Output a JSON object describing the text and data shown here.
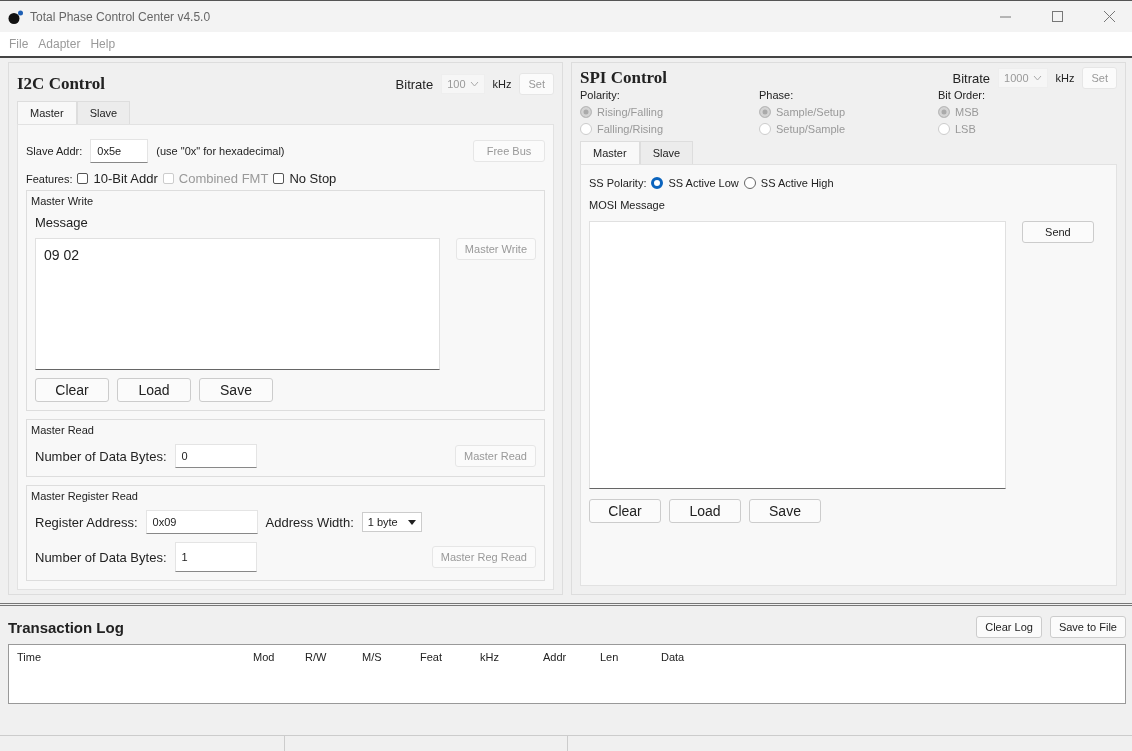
{
  "window": {
    "title": "Total Phase Control Center v4.5.0"
  },
  "menu": [
    {
      "label": "File"
    },
    {
      "label": "Adapter"
    },
    {
      "label": "Help"
    }
  ],
  "i2c": {
    "title": "I2C Control",
    "bitrate": {
      "label": "Bitrate",
      "value": "100",
      "unit": "kHz",
      "set": "Set",
      "disabled": true
    },
    "tabs": [
      {
        "label": "Master",
        "selected": true
      },
      {
        "label": "Slave",
        "selected": false
      }
    ],
    "slave_addr": {
      "label": "Slave Addr:",
      "value": "0x5e",
      "hint": "(use \"0x\" for hexadecimal)"
    },
    "free_bus": {
      "label": "Free Bus",
      "disabled": true
    },
    "features": {
      "label": "Features:",
      "options": [
        {
          "label": "10-Bit Addr",
          "checked": false,
          "disabled": false
        },
        {
          "label": "Combined FMT",
          "checked": false,
          "disabled": true
        },
        {
          "label": "No Stop",
          "checked": false,
          "disabled": false
        }
      ]
    },
    "master_write": {
      "title": "Master Write",
      "message_label": "Message",
      "message": "09 02",
      "button": {
        "label": "Master Write",
        "disabled": true
      },
      "buttons": [
        "Clear",
        "Load",
        "Save"
      ]
    },
    "master_read": {
      "title": "Master Read",
      "bytes_label": "Number of Data Bytes:",
      "bytes": "0",
      "button": {
        "label": "Master Read",
        "disabled": true
      }
    },
    "master_register_read": {
      "title": "Master Register Read",
      "address_label": "Register Address:",
      "address": "0x09",
      "width_label": "Address Width:",
      "width": "1 byte",
      "bytes_label": "Number of Data Bytes:",
      "bytes": "1",
      "button": {
        "label": "Master Reg Read",
        "disabled": true
      }
    }
  },
  "spi": {
    "title": "SPI Control",
    "bitrate": {
      "label": "Bitrate",
      "value": "1000",
      "unit": "kHz",
      "set": "Set",
      "disabled": true
    },
    "groups": [
      {
        "label": "Polarity:",
        "disabled": true,
        "options": [
          {
            "label": "Rising/Falling",
            "selected": true
          },
          {
            "label": "Falling/Rising",
            "selected": false
          }
        ]
      },
      {
        "label": "Phase:",
        "disabled": true,
        "options": [
          {
            "label": "Sample/Setup",
            "selected": true
          },
          {
            "label": "Setup/Sample",
            "selected": false
          }
        ]
      },
      {
        "label": "Bit Order:",
        "disabled": true,
        "options": [
          {
            "label": "MSB",
            "selected": true
          },
          {
            "label": "LSB",
            "selected": false
          }
        ]
      }
    ],
    "tabs": [
      {
        "label": "Master",
        "selected": true
      },
      {
        "label": "Slave",
        "selected": false
      }
    ],
    "ss_polarity": {
      "label": "SS Polarity:",
      "options": [
        {
          "label": "SS Active Low",
          "selected": true
        },
        {
          "label": "SS Active High",
          "selected": false
        }
      ]
    },
    "mosi_label": "MOSI Message",
    "send": "Send",
    "buttons": [
      "Clear",
      "Load",
      "Save"
    ]
  },
  "log": {
    "title": "Transaction Log",
    "buttons": [
      "Clear Log",
      "Save to File"
    ],
    "columns": [
      "Time",
      "Mod",
      "R/W",
      "M/S",
      "Feat",
      "kHz",
      "Addr",
      "Len",
      "Data"
    ]
  }
}
